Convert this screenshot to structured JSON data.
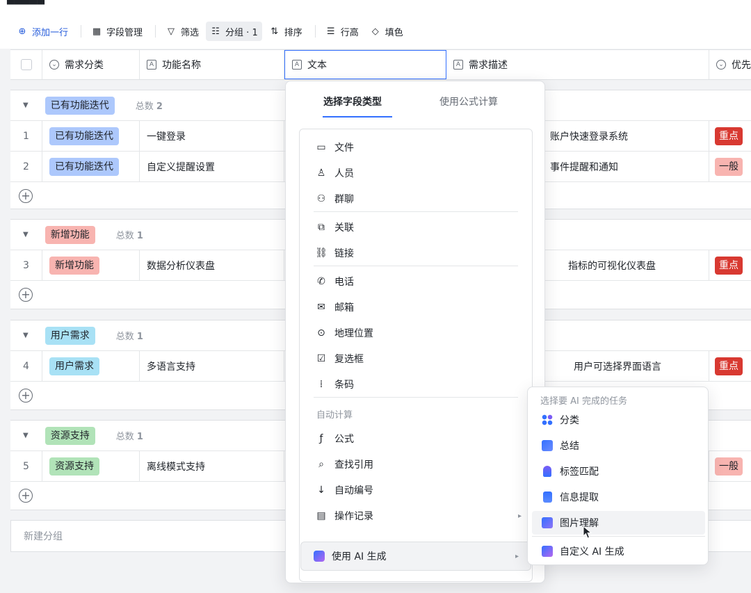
{
  "toolbar": {
    "add_row": "添加一行",
    "field_manage": "字段管理",
    "filter": "筛选",
    "group": "分组 · 1",
    "sort": "排序",
    "row_height": "行高",
    "fill_color": "填色"
  },
  "columns": {
    "category": "需求分类",
    "feature": "功能名称",
    "text": "文本",
    "description": "需求描述",
    "priority": "优先"
  },
  "groups": [
    {
      "name": "已有功能迭代",
      "count_label": "总数",
      "count": "2",
      "rows": [
        {
          "num": "1",
          "category": "已有功能迭代",
          "feature": "一键登录",
          "desc": "账户快速登录系统",
          "priority": "重点"
        },
        {
          "num": "2",
          "category": "已有功能迭代",
          "feature": "自定义提醒设置",
          "desc": "事件提醒和通知",
          "priority": "一般"
        }
      ]
    },
    {
      "name": "新增功能",
      "count_label": "总数",
      "count": "1",
      "rows": [
        {
          "num": "3",
          "category": "新增功能",
          "feature": "数据分析仪表盘",
          "desc": "指标的可视化仪表盘",
          "priority": "重点"
        }
      ]
    },
    {
      "name": "用户需求",
      "count_label": "总数",
      "count": "1",
      "rows": [
        {
          "num": "4",
          "category": "用户需求",
          "feature": "多语言支持",
          "desc": "用户可选择界面语言",
          "priority": "重点"
        }
      ]
    },
    {
      "name": "资源支持",
      "count_label": "总数",
      "count": "1",
      "rows": [
        {
          "num": "5",
          "category": "资源支持",
          "feature": "离线模式支持",
          "desc": "",
          "priority": "一般"
        }
      ]
    }
  ],
  "new_group": "新建分组",
  "popover": {
    "tab_field_type": "选择字段类型",
    "tab_formula": "使用公式计算",
    "items": {
      "file": "文件",
      "person": "人员",
      "group_chat": "群聊",
      "link_record": "关联",
      "url": "链接",
      "phone": "电话",
      "email": "邮箱",
      "location": "地理位置",
      "checkbox": "复选框",
      "barcode": "条码",
      "formula": "公式",
      "lookup": "查找引用",
      "auto_number": "自动编号",
      "operation_log": "操作记录"
    },
    "section_auto": "自动计算",
    "ai_generate": "使用 AI 生成"
  },
  "submenu": {
    "header": "选择要 AI 完成的任务",
    "classify": "分类",
    "summarize": "总结",
    "tag_match": "标签匹配",
    "extract": "信息提取",
    "image_understand": "图片理解",
    "custom_ai": "自定义 AI 生成"
  },
  "colors": {
    "accent": "#3370ff",
    "priority_high": "#d83931",
    "priority_low": "#f8b4b0"
  }
}
